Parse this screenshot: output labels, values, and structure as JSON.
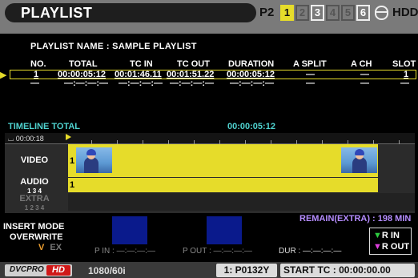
{
  "header": {
    "title": "PLAYLIST",
    "p2_label": "P2",
    "slots": [
      "1",
      "2",
      "3",
      "4",
      "5",
      "6"
    ],
    "hdd_label": "HDD"
  },
  "playlist": {
    "name_label": "PLAYLIST NAME :  SAMPLE PLAYLIST",
    "columns": [
      "NO.",
      "TOTAL",
      "TC IN",
      "TC OUT",
      "DURATION",
      "A SPLIT",
      "A CH",
      "SLOT"
    ],
    "rows": [
      [
        "1",
        "00:00:05:12",
        "00:01:46.11",
        "00:01:51.22",
        "00:00:05:12",
        "—",
        "—",
        "1"
      ],
      [
        "—",
        "—:—:—:—",
        "—:—:—:—",
        "—:—:—:—",
        "—:—:—:—",
        "—",
        "—",
        "—"
      ]
    ]
  },
  "timeline": {
    "total_label": "TIMELINE TOTAL",
    "total_value": "00:00:05:12",
    "ruler_time": "00:00:18",
    "tracks": {
      "video": "VIDEO",
      "audio": "AUDIO",
      "audio_ch": "1 3 4",
      "extra": "EXTRA",
      "extra_ch": "1 2 3 4"
    },
    "video_clip_no": "1",
    "audio_clip_no": "1"
  },
  "edit": {
    "insert_mode": "INSERT MODE",
    "overwrite": "OVERWRITE",
    "v": "V",
    "ex": "EX",
    "p_in": "P IN : —:—:—:—",
    "p_out": "P OUT : —:—:—:—",
    "dur": "DUR : —:—:—:—",
    "remain": "REMAIN(EXTRA) : 198 MIN",
    "r_in": "R IN",
    "r_out": "R OUT"
  },
  "footer": {
    "codec": "DVCPRO",
    "codec_hd": "HD",
    "format": "1080/60i",
    "clip_id": "1: P0132Y",
    "start_tc": "START TC   : 00:00:00.00"
  },
  "colors": {
    "accent_yellow": "#e6dc2a",
    "timeline_cyan": "#4fd3d0",
    "remain_purple": "#b58cff",
    "box_blue": "#0a1a8c"
  }
}
